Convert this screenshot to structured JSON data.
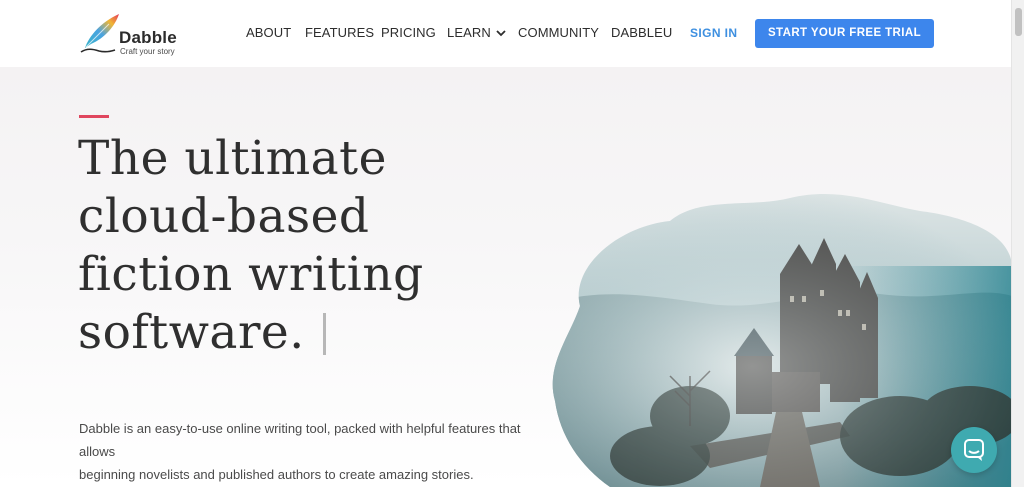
{
  "brand": {
    "name": "Dabble",
    "tagline": "Craft your story"
  },
  "nav": {
    "items": [
      {
        "label": "ABOUT"
      },
      {
        "label": "FEATURES"
      },
      {
        "label": "PRICING"
      },
      {
        "label": "LEARN"
      },
      {
        "label": "COMMUNITY"
      },
      {
        "label": "DABBLEU"
      }
    ],
    "signin": "SIGN IN",
    "cta": "START YOUR FREE TRIAL"
  },
  "hero": {
    "headline_lines": [
      "The ultimate",
      "cloud-based",
      "fiction writing",
      "software."
    ],
    "description_lines": [
      "Dabble is an easy-to-use online writing tool, packed with helpful features that allows",
      "beginning novelists and published authors to create amazing stories."
    ]
  },
  "icons": {
    "logo": "quill-feather-icon",
    "learn_dropdown": "chevron-down-icon",
    "chat": "chat-bubble-icon"
  },
  "colors": {
    "accent": "#e0465e",
    "cta": "#3d86ec",
    "signin": "#3d8fe0",
    "chat": "#3faab0",
    "text": "#2f2f2f"
  }
}
